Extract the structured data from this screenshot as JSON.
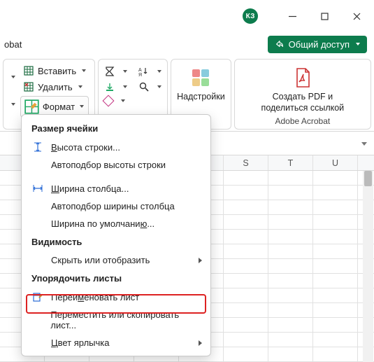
{
  "window": {
    "user_initials": "КЗ"
  },
  "tabbar": {
    "acrobat_tab": "obat",
    "share": "Общий доступ"
  },
  "ribbon": {
    "cells": {
      "insert": "Вставить",
      "delete": "Удалить",
      "format": "Формат"
    },
    "addins": {
      "label": "Надстройки"
    },
    "acrobat": {
      "line1": "Создать PDF и",
      "line2": "поделиться ссылкой",
      "group": "Adobe Acrobat"
    }
  },
  "grid": {
    "columns": [
      "",
      "",
      "",
      "",
      "",
      "S",
      "T",
      "U"
    ]
  },
  "menu": {
    "sec1": "Размер ячейки",
    "row_height": "ысота строки...",
    "row_height_u": "В",
    "autofit_row": "Автоподбор высоты строки",
    "col_width": "ирина столбца...",
    "col_width_u": "Ш",
    "autofit_col": "Автоподбор ширины столбца",
    "default_width_pre": "Ширина по умолчани",
    "default_width_u": "ю",
    "default_width_post": "...",
    "sec2": "Видимость",
    "hide_show": "Скрыть или отобразить",
    "sec3": "Упорядочить листы",
    "rename_pre": "Переи",
    "rename_u": "м",
    "rename_post": "еновать лист",
    "move_copy": "Переместить или скопировать лист...",
    "tab_color": "вет ярлычка",
    "tab_color_u": "Ц"
  }
}
